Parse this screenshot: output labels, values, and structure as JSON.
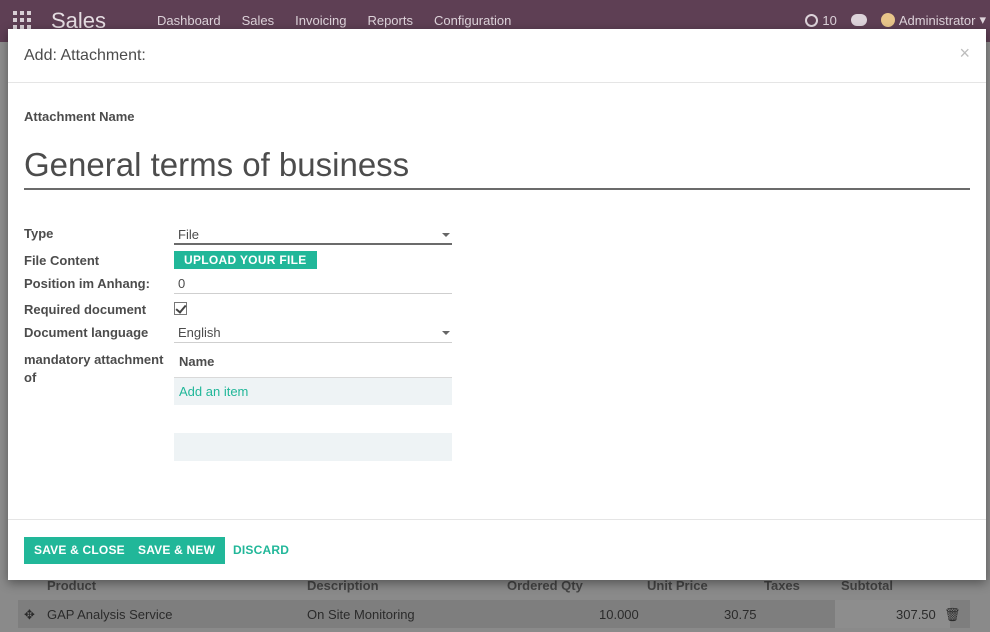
{
  "navbar": {
    "app_name": "Sales",
    "menu": [
      "Dashboard",
      "Sales",
      "Invoicing",
      "Reports",
      "Configuration"
    ],
    "notifications_count": "10",
    "user": "Administrator",
    "color": "#5e3f54"
  },
  "background_table": {
    "headers": [
      "Product",
      "Description",
      "Ordered Qty",
      "Unit Price",
      "Taxes",
      "Subtotal"
    ],
    "row": {
      "product": "GAP Analysis Service",
      "description": "On Site Monitoring",
      "qty": "10.000",
      "unit_price": "30.75",
      "subtotal": "307.50"
    }
  },
  "modal": {
    "title": "Add: Attachment:",
    "close_symbol": "×",
    "name_label": "Attachment Name",
    "name_value": "General terms of business",
    "fields": {
      "type_label": "Type",
      "type_value": "File",
      "file_content_label": "File Content",
      "upload_label": "UPLOAD YOUR FILE",
      "position_label": "Position im Anhang:",
      "position_value": "0",
      "required_label": "Required document",
      "required_checked": true,
      "language_label": "Document language",
      "language_value": "English",
      "mandatory_label": "mandatory attachment of"
    },
    "o2m": {
      "column_name": "Name",
      "add_item": "Add an item"
    },
    "footer": {
      "save_close": "SAVE & CLOSE",
      "save_new": "SAVE & NEW",
      "discard": "DISCARD"
    },
    "accent_color": "#21b799"
  }
}
